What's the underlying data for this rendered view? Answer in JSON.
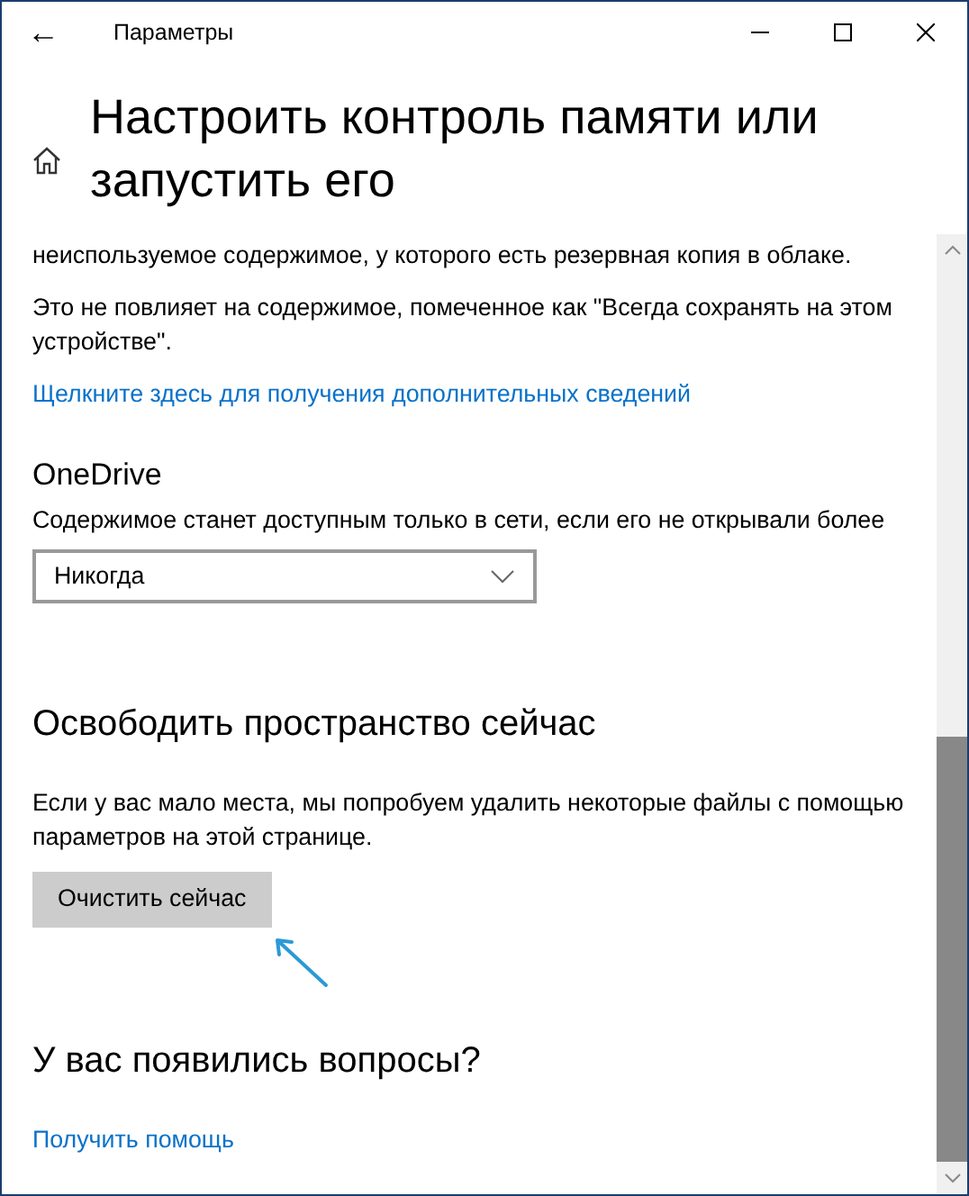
{
  "window": {
    "title": "Параметры",
    "back": "←",
    "controls": [
      {
        "kind": "minimize"
      },
      {
        "kind": "maximize"
      },
      {
        "kind": "close"
      }
    ]
  },
  "header": {
    "title": "Настроить контроль памяти или запустить его"
  },
  "sections": [
    {
      "kind": "text",
      "text": "неиспользуемое содержимое, у которого есть резервная копия в облаке."
    },
    {
      "kind": "text",
      "text": "Это не повлияет на содержимое, помеченное как \"Всегда сохранять на этом устройстве\"."
    },
    {
      "kind": "link",
      "text": "Щелкните здесь для получения дополнительных сведений"
    },
    {
      "kind": "subheading",
      "text": "OneDrive"
    },
    {
      "kind": "label",
      "text": "Содержимое станет доступным только в сети, если его не открывали более"
    },
    {
      "kind": "dropdown",
      "value": "Никогда"
    },
    {
      "kind": "heading",
      "text": "Освободить пространство сейчас"
    },
    {
      "kind": "text",
      "text": "Если у вас мало места, мы попробуем удалить некоторые файлы с помощью параметров на этой странице."
    },
    {
      "kind": "button",
      "text": "Очистить сейчас"
    },
    {
      "kind": "heading",
      "text": "У вас появились вопросы?"
    },
    {
      "kind": "link",
      "text": "Получить помощь"
    }
  ]
}
